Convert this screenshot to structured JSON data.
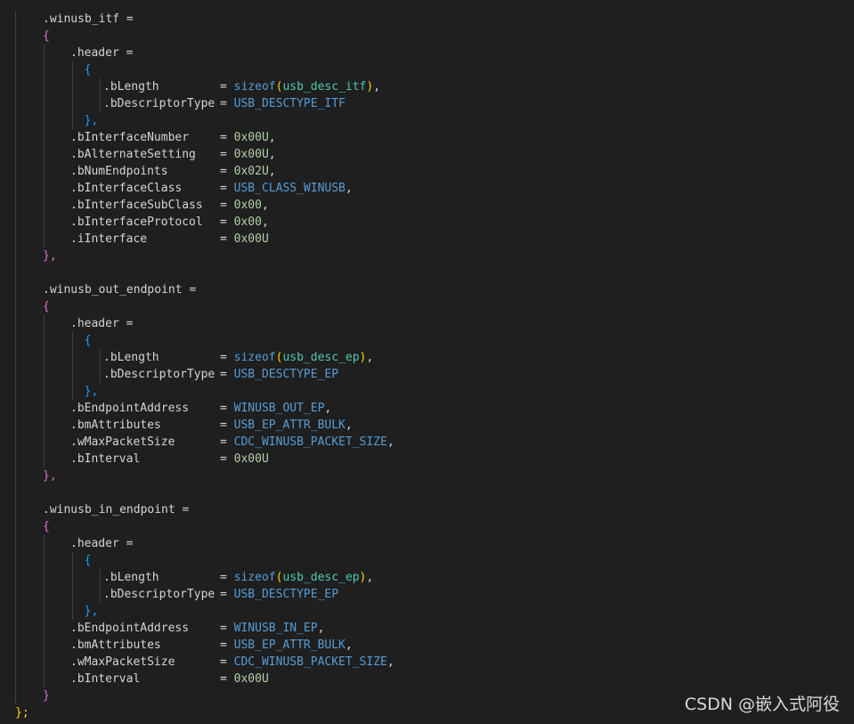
{
  "blocks": [
    {
      "name": ".winusb_itf",
      "header_bLength_func": "sizeof",
      "header_bLength_arg": "usb_desc_itf",
      "header_bDescriptorType": "USB_DESCTYPE_ITF",
      "fields": [
        {
          "key": ".bInterfaceNumber",
          "value": "0x00U",
          "sep": ","
        },
        {
          "key": ".bAlternateSetting",
          "value": "0x00U",
          "sep": ","
        },
        {
          "key": ".bNumEndpoints",
          "value": "0x02U",
          "sep": ","
        },
        {
          "key": ".bInterfaceClass",
          "value": "USB_CLASS_WINUSB",
          "sep": ","
        },
        {
          "key": ".bInterfaceSubClass",
          "value": "0x00",
          "sep": ","
        },
        {
          "key": ".bInterfaceProtocol",
          "value": "0x00",
          "sep": ","
        },
        {
          "key": ".iInterface",
          "value": "0x00U",
          "sep": ""
        }
      ],
      "close": "},"
    },
    {
      "name": ".winusb_out_endpoint",
      "header_bLength_func": "sizeof",
      "header_bLength_arg": "usb_desc_ep",
      "header_bDescriptorType": "USB_DESCTYPE_EP",
      "fields": [
        {
          "key": ".bEndpointAddress",
          "value": "WINUSB_OUT_EP",
          "sep": ","
        },
        {
          "key": ".bmAttributes",
          "value": "USB_EP_ATTR_BULK",
          "sep": ","
        },
        {
          "key": ".wMaxPacketSize",
          "value": "CDC_WINUSB_PACKET_SIZE",
          "sep": ","
        },
        {
          "key": ".bInterval",
          "value": "0x00U",
          "sep": ""
        }
      ],
      "close": "},"
    },
    {
      "name": ".winusb_in_endpoint",
      "header_bLength_func": "sizeof",
      "header_bLength_arg": "usb_desc_ep",
      "header_bDescriptorType": "USB_DESCTYPE_EP",
      "fields": [
        {
          "key": ".bEndpointAddress",
          "value": "WINUSB_IN_EP",
          "sep": ","
        },
        {
          "key": ".bmAttributes",
          "value": "USB_EP_ATTR_BULK",
          "sep": ","
        },
        {
          "key": ".wMaxPacketSize",
          "value": "CDC_WINUSB_PACKET_SIZE",
          "sep": ","
        },
        {
          "key": ".bInterval",
          "value": "0x00U",
          "sep": ""
        }
      ],
      "close": "}"
    }
  ],
  "tokens": {
    "assign": "=",
    "open_brace": "{",
    "header": ".header",
    "bLength": ".bLength",
    "bDescriptorType": ".bDescriptorType",
    "header_close": "},",
    "final_close": "};"
  },
  "watermark": "CSDN @嵌入式阿役",
  "colors": {
    "background": "#1f1f1f",
    "text": "#d4d4d4",
    "keyword": "#569cd6",
    "type": "#4ec9b0",
    "number": "#b5cea8",
    "bracket_level1": "#ffd700",
    "bracket_level2": "#da70d6",
    "bracket_level3": "#179fff"
  }
}
